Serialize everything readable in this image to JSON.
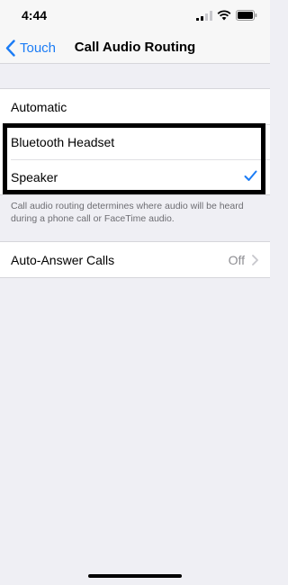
{
  "status_bar": {
    "time": "4:44"
  },
  "nav": {
    "back_label": "Touch",
    "title": "Call Audio Routing"
  },
  "routing_options": [
    {
      "label": "Automatic",
      "selected": false
    },
    {
      "label": "Bluetooth Headset",
      "selected": false
    },
    {
      "label": "Speaker",
      "selected": true
    }
  ],
  "routing_footnote": "Call audio routing determines where audio will be heard during a phone call or FaceTime audio.",
  "auto_answer": {
    "label": "Auto-Answer Calls",
    "value": "Off"
  },
  "colors": {
    "accent": "#1b7cf5",
    "background": "#efeff4",
    "secondary_text": "#8e8e93"
  }
}
